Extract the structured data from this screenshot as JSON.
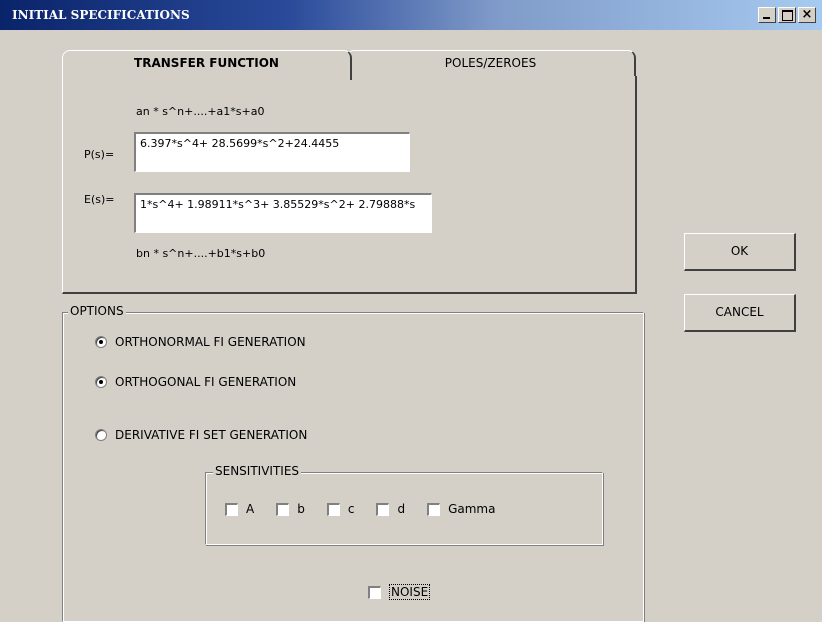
{
  "window": {
    "title": "INITIAL SPECIFICATIONS",
    "close_glyph": "×"
  },
  "tabs": [
    {
      "label": "TRANSFER FUNCTION",
      "active": true
    },
    {
      "label": "POLES/ZEROES",
      "active": false
    }
  ],
  "transfer_function": {
    "numerator_hint": "an * s^n+....+a1*s+a0",
    "p_label": "P(s)=",
    "p_value": "6.397*s^4+ 28.5699*s^2+24.4455",
    "e_label": "E(s)=",
    "e_value": "1*s^4+ 1.98911*s^3+ 3.85529*s^2+ 2.79888*s",
    "denominator_hint": "bn * s^n+....+b1*s+b0"
  },
  "buttons": {
    "ok": "OK",
    "cancel": "CANCEL"
  },
  "options": {
    "label": "OPTIONS",
    "radios": [
      {
        "label": "ORTHONORMAL FI GENERATION",
        "checked": true
      },
      {
        "label": "ORTHOGONAL FI GENERATION",
        "checked": true
      },
      {
        "label": "DERIVATIVE FI SET GENERATION",
        "checked": false
      }
    ],
    "sensitivities": {
      "label": "SENSITIVITIES",
      "items": [
        {
          "label": "A",
          "checked": false
        },
        {
          "label": "b",
          "checked": false
        },
        {
          "label": "c",
          "checked": false
        },
        {
          "label": "d",
          "checked": false
        },
        {
          "label": "Gamma",
          "checked": false
        }
      ]
    },
    "noise": {
      "label": "NOISE",
      "checked": false
    }
  }
}
